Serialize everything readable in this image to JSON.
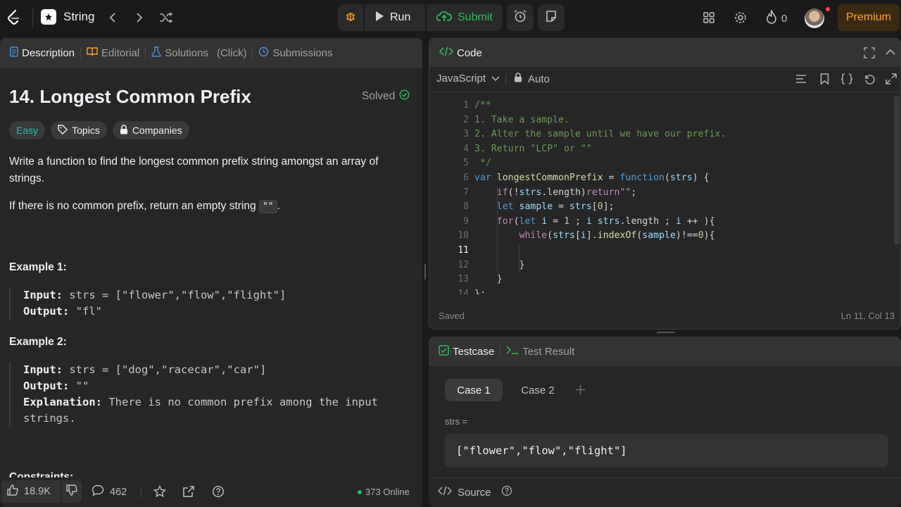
{
  "header": {
    "problem_list_label": "String",
    "run_label": "Run",
    "submit_label": "Submit",
    "coins": "0",
    "premium_label": "Premium"
  },
  "left_tabs": {
    "description": "Description",
    "editorial": "Editorial",
    "solutions": "Solutions",
    "click_hint": "(Click)",
    "submissions": "Submissions"
  },
  "problem": {
    "title": "14. Longest Common Prefix",
    "status": "Solved",
    "difficulty": "Easy",
    "topics_label": "Topics",
    "companies_label": "Companies",
    "description_1": "Write a function to find the longest common prefix string amongst an array of strings.",
    "description_2_prefix": "If there is no common prefix, return an empty string",
    "description_2_code": "\"\"",
    "description_2_suffix": ".",
    "examples": [
      {
        "heading": "Example 1:",
        "input_label": "Input:",
        "input": "strs = [\"flower\",\"flow\",\"flight\"]",
        "output_label": "Output:",
        "output": "\"fl\""
      },
      {
        "heading": "Example 2:",
        "input_label": "Input:",
        "input": "strs = [\"dog\",\"racecar\",\"car\"]",
        "output_label": "Output:",
        "output": "\"\"",
        "explanation_label": "Explanation:",
        "explanation_1": "There is no common prefix among the input",
        "explanation_2": "strings."
      }
    ],
    "constraints_heading": "Constraints:"
  },
  "footer": {
    "likes": "18.9K",
    "comments": "462",
    "online": "373 Online"
  },
  "code_panel": {
    "title": "Code",
    "language": "JavaScript",
    "mode": "Auto",
    "status": "Saved",
    "cursor": "Ln 11, Col 13",
    "active_line": 11,
    "lines": [
      {
        "n": "1",
        "html": "<span style='color:#6a9955'>/**</span>"
      },
      {
        "n": "2",
        "html": "<span style='color:#6a9955'>1. Take a sample.</span>"
      },
      {
        "n": "3",
        "html": "<span style='color:#6a9955'>2. Alter the sample until we have our prefix.</span>"
      },
      {
        "n": "4",
        "html": "<span style='color:#6a9955'>3. Return \"LCP\" or \"\"</span>"
      },
      {
        "n": "5",
        "html": "<span style='color:#6a9955'> */</span>"
      },
      {
        "n": "6",
        "html": "<span style='color:#569cd6'>var</span> <span style='color:#dcdcaa'>longestCommonPrefix</span> = <span style='color:#569cd6'>function</span>(<span style='color:#9cdcfe'>strs</span>) {"
      },
      {
        "n": "7",
        "html": "    <span style='color:#c586c0'>if</span>(!<span style='color:#9cdcfe'>strs</span>.length)<span style='color:#c586c0'>return</span><span style='color:#ce9178'>\"\"</span>;"
      },
      {
        "n": "8",
        "html": "    <span style='color:#569cd6'>let</span> <span style='color:#9cdcfe'>sample</span> = <span style='color:#9cdcfe'>strs</span>[<span style='color:#b5cea8'>0</span>];"
      },
      {
        "n": "9",
        "html": "    <span style='color:#c586c0'>for</span>(<span style='color:#569cd6'>let</span> <span style='color:#9cdcfe'>i</span> = <span style='color:#b5cea8'>1</span> ; <span style='color:#9cdcfe'>i</span> <span style='color:#9cdcfe'>strs</span>.length ; <span style='color:#9cdcfe'>i</span> ++ ){"
      },
      {
        "n": "10",
        "html": "        <span style='color:#c586c0'>while</span>(<span style='color:#9cdcfe'>strs</span>[<span style='color:#9cdcfe'>i</span>].<span style='color:#dcdcaa'>indexOf</span>(<span style='color:#9cdcfe'>sample</span>)!==<span style='color:#b5cea8'>0</span>){"
      },
      {
        "n": "11",
        "html": ""
      },
      {
        "n": "12",
        "html": "        }"
      },
      {
        "n": "13",
        "html": "    }"
      },
      {
        "n": "14",
        "html": "};"
      }
    ]
  },
  "test_panel": {
    "testcase_label": "Testcase",
    "result_label": "Test Result",
    "case1": "Case 1",
    "case2": "Case 2",
    "param_label": "strs =",
    "param_value": "[\"flower\",\"flow\",\"flight\"]",
    "source_label": "Source"
  },
  "colors": {
    "accent": "#ffa116",
    "green": "#2cbb5d",
    "easy": "#1cbaba",
    "blue": "#4a90e2"
  }
}
